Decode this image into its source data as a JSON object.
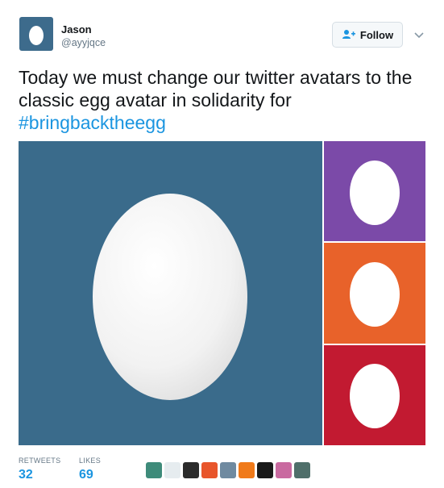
{
  "author": {
    "name": "Jason",
    "handle": "@ayyjqce"
  },
  "follow_button": {
    "label": "Follow"
  },
  "tweet": {
    "text": "Today we must change our twitter avatars to the classic egg avatar in solidarity for",
    "hashtag": "#bringbacktheegg"
  },
  "media": {
    "images": [
      {
        "name": "egg-blue",
        "color": "#3a6b8b"
      },
      {
        "name": "egg-purple",
        "color": "#7b4aa8"
      },
      {
        "name": "egg-orange",
        "color": "#e8622a"
      },
      {
        "name": "egg-red",
        "color": "#c21a31"
      }
    ]
  },
  "stats": {
    "retweets_label": "RETWEETS",
    "retweets": "32",
    "likes_label": "LIKES",
    "likes": "69"
  },
  "likers": [
    {
      "name": "liker-1",
      "color": "#3e8b7a"
    },
    {
      "name": "liker-2",
      "color": "#e6ecef"
    },
    {
      "name": "liker-3",
      "color": "#2b2b2b"
    },
    {
      "name": "liker-4",
      "color": "#e8552b"
    },
    {
      "name": "liker-5",
      "color": "#6f8aa0"
    },
    {
      "name": "liker-6",
      "color": "#f07a1a"
    },
    {
      "name": "liker-7",
      "color": "#1a1a1a"
    },
    {
      "name": "liker-8",
      "color": "#c96aa0"
    },
    {
      "name": "liker-9",
      "color": "#4f6f6a"
    }
  ]
}
